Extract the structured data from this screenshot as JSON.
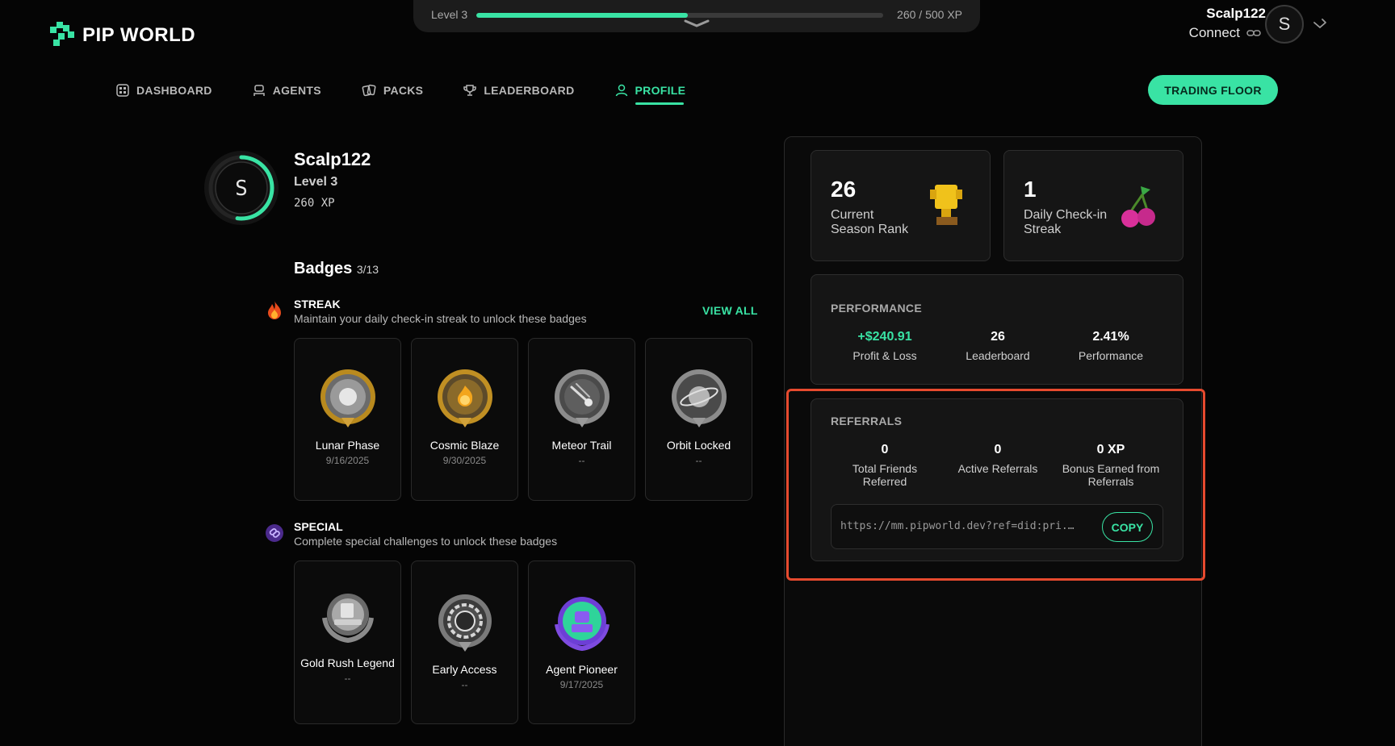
{
  "xp_bar": {
    "level_label": "Level 3",
    "xp_label": "260 / 500 XP",
    "progress": 0.52
  },
  "brand": {
    "name": "PIP WORLD",
    "accent": "#39e3a4"
  },
  "user": {
    "name": "Scalp122",
    "connect_label": "Connect",
    "avatar_letter": "S"
  },
  "nav": [
    {
      "label": "DASHBOARD",
      "icon": "dashboard-icon"
    },
    {
      "label": "AGENTS",
      "icon": "robot-icon"
    },
    {
      "label": "PACKS",
      "icon": "cards-icon"
    },
    {
      "label": "LEADERBOARD",
      "icon": "trophy-icon"
    },
    {
      "label": "PROFILE",
      "icon": "user-icon",
      "active": true
    }
  ],
  "trading_floor_label": "TRADING FLOOR",
  "profile": {
    "name": "Scalp122",
    "level": "Level 3",
    "xp": "260 XP",
    "avatar_letter": "S",
    "level_progress": 0.52
  },
  "badges": {
    "title": "Badges",
    "count": "3/13",
    "view_all": "VIEW ALL",
    "streak": {
      "title": "STREAK",
      "desc": "Maintain your daily check-in streak to unlock these badges",
      "items": [
        {
          "name": "Lunar Phase",
          "date": "9/16/2025"
        },
        {
          "name": "Cosmic Blaze",
          "date": "9/30/2025"
        },
        {
          "name": "Meteor Trail",
          "date": "--"
        },
        {
          "name": "Orbit Locked",
          "date": "--"
        }
      ]
    },
    "special": {
      "title": "SPECIAL",
      "desc": "Complete special challenges to unlock these badges",
      "items": [
        {
          "name": "Gold Rush Legend",
          "date": "--"
        },
        {
          "name": "Early Access",
          "date": "--"
        },
        {
          "name": "Agent Pioneer",
          "date": "9/17/2025"
        }
      ]
    }
  },
  "stats": {
    "rank": {
      "value": "26",
      "label": "Current Season Rank"
    },
    "streak": {
      "value": "1",
      "label": "Daily Check-in Streak"
    }
  },
  "performance": {
    "title": "PERFORMANCE",
    "pnl": {
      "value": "+$240.91",
      "label": "Profit & Loss"
    },
    "leaderboard": {
      "value": "26",
      "label": "Leaderboard"
    },
    "performance": {
      "value": "2.41%",
      "label": "Performance"
    }
  },
  "referrals": {
    "title": "REFERRALS",
    "total": {
      "value": "0",
      "label": "Total Friends Referred"
    },
    "active": {
      "value": "0",
      "label": "Active Referrals"
    },
    "bonus": {
      "value": "0 XP",
      "label": "Bonus Earned from Referrals"
    },
    "link": "https://mm.pipworld.dev?ref=did:pri...",
    "copy_label": "COPY"
  }
}
